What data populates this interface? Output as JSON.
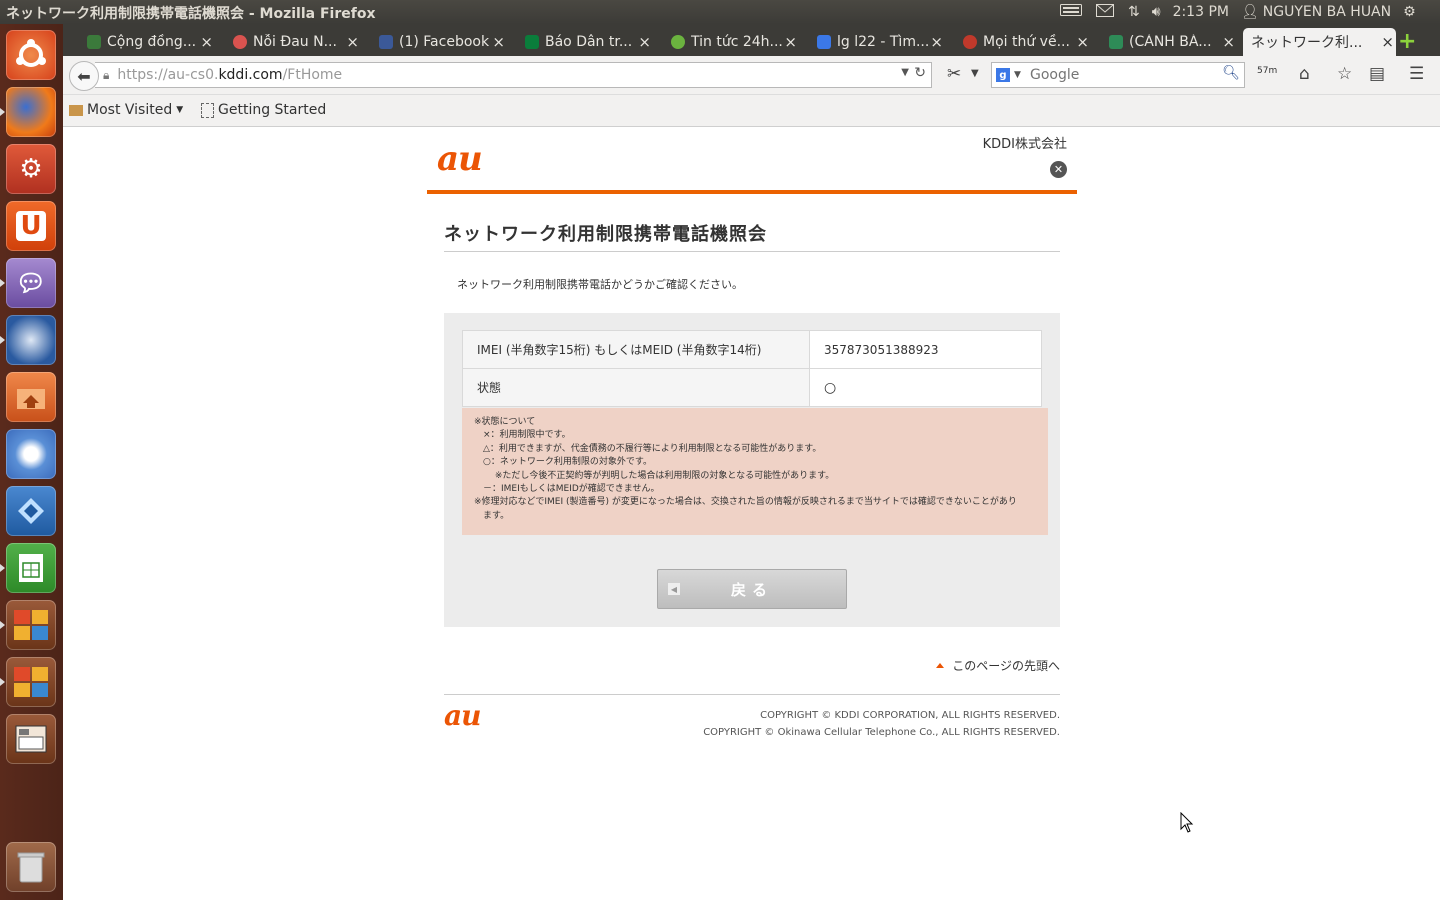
{
  "panel": {
    "window_title": "ネットワーク利用制限携帯電話機照会 - Mozilla Firefox",
    "time": "2:13 PM",
    "user": "NGUYEN BA HUAN",
    "icons": [
      "keyboard-icon",
      "mail-icon",
      "network-icon",
      "volume-icon",
      "user-icon",
      "gear-icon"
    ]
  },
  "launcher": {
    "items": [
      "ubuntu-dash",
      "firefox",
      "system-settings",
      "ubuntu-one",
      "pidgin",
      "thunderbird",
      "files",
      "chromium",
      "virtualbox",
      "libreoffice-calc",
      "workspace-switcher-1",
      "workspace-switcher-2",
      "window-spread",
      "trash"
    ]
  },
  "tabs": [
    {
      "label": "Cộng đồng...",
      "color": "#3b7a3b"
    },
    {
      "label": "Nỗi Đau N...",
      "color": "#d9534f"
    },
    {
      "label": "(1) Facebook",
      "color": "#3b5998"
    },
    {
      "label": "Báo Dân tr...",
      "color": "#0a7d3b"
    },
    {
      "label": "Tin tức 24h...",
      "color": "#6bb33f"
    },
    {
      "label": "lg l22 - Tìm...",
      "color": "#3b78e7"
    },
    {
      "label": "Mọi thứ về...",
      "color": "#c0392b"
    },
    {
      "label": "(CẢNH BÁ...",
      "color": "#2e8b57"
    },
    {
      "label": "ネットワーク利...",
      "color": "#f2f1f0"
    }
  ],
  "navbar": {
    "url_scheme": "https://au-cs0.",
    "url_domain": "kddi.com",
    "url_path": "/FtHome",
    "search_placeholder": "Google",
    "download_badge": "57m"
  },
  "bookmarks": {
    "most_visited": "Most Visited",
    "getting_started": "Getting Started"
  },
  "page": {
    "logo": "au",
    "company": "KDDI株式会社",
    "title": "ネットワーク利用制限携帯電話機照会",
    "intro": "ネットワーク利用制限携帯電話かどうかご確認ください。",
    "table": {
      "imei_label": "IMEI (半角数字15桁) もしくはMEID (半角数字14桁)",
      "imei_value": "357873051388923",
      "status_label": "状態",
      "status_value": "○"
    },
    "notes": [
      "※状態について",
      "　×：利用制限中です。",
      "　△：利用できますが、代金債務の不履行等により利用制限となる可能性があります。",
      "　○：ネットワーク利用制限の対象外です。",
      "　　 ※ただし今後不正契約等が判明した場合は利用制限の対象となる可能性があります。",
      "　－：IMEIもしくはMEIDが確認できません。",
      "※修理対応などでIMEI (製造番号) が変更になった場合は、交換された旨の情報が反映されるまで当サイトでは確認できないことがあり",
      "　ます。"
    ],
    "back_button": "戻る",
    "page_top": "このページの先頭へ",
    "copyright_1": "COPYRIGHT © KDDI CORPORATION, ALL RIGHTS RESERVED.",
    "copyright_2": "COPYRIGHT © Okinawa Cellular Telephone Co., ALL RIGHTS RESERVED.",
    "accent_color": "#eb5505"
  }
}
